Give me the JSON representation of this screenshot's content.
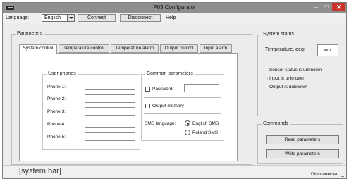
{
  "window": {
    "title": "P03 Configurator",
    "min_glyph": "–",
    "max_glyph": "□",
    "close_glyph": "✕"
  },
  "menubar": {
    "language_label": "Language:",
    "language_value": "English",
    "connect_label": "Connect",
    "disconnect_label": "Disconnect",
    "help_label": "Help"
  },
  "parameters": {
    "title": "Parameters",
    "tabs": [
      "System control",
      "Temperature control",
      "Temperature alarm",
      "Output control",
      "Input alarm"
    ],
    "active_tab": "System control",
    "user_phones": {
      "title": "User phones",
      "phones": [
        {
          "label": "Phone 1:",
          "value": ""
        },
        {
          "label": "Phone 2:",
          "value": ""
        },
        {
          "label": "Phone 3:",
          "value": ""
        },
        {
          "label": "Phone 4:",
          "value": ""
        },
        {
          "label": "Phone 5:",
          "value": ""
        }
      ]
    },
    "common": {
      "title": "Common parameters",
      "password_label": "Password:",
      "password_value": "",
      "password_checked": false,
      "output_memory_label": "Output memory",
      "output_memory_checked": false,
      "sms_language_label": "SMS language:",
      "sms_options": [
        "English SMS",
        "Poland SMS"
      ],
      "sms_selected": "English SMS"
    }
  },
  "system_status": {
    "title": "System status",
    "temperature_label": "Temperature, deg:",
    "temperature_value": "--.-",
    "lines": [
      "- Sensor status is unknown",
      "- Input is unknown",
      "- Output is unknown"
    ]
  },
  "commands": {
    "title": "Commands",
    "read_label": "Read parameters",
    "write_label": "Write parameters"
  },
  "statusbar": {
    "system_bar_label": "[system bar]",
    "connection_status": "Disconnected"
  },
  "colors": {
    "title_bar": "#8f8f8f",
    "close_button": "#c9322b",
    "window_bg": "#ececec"
  }
}
